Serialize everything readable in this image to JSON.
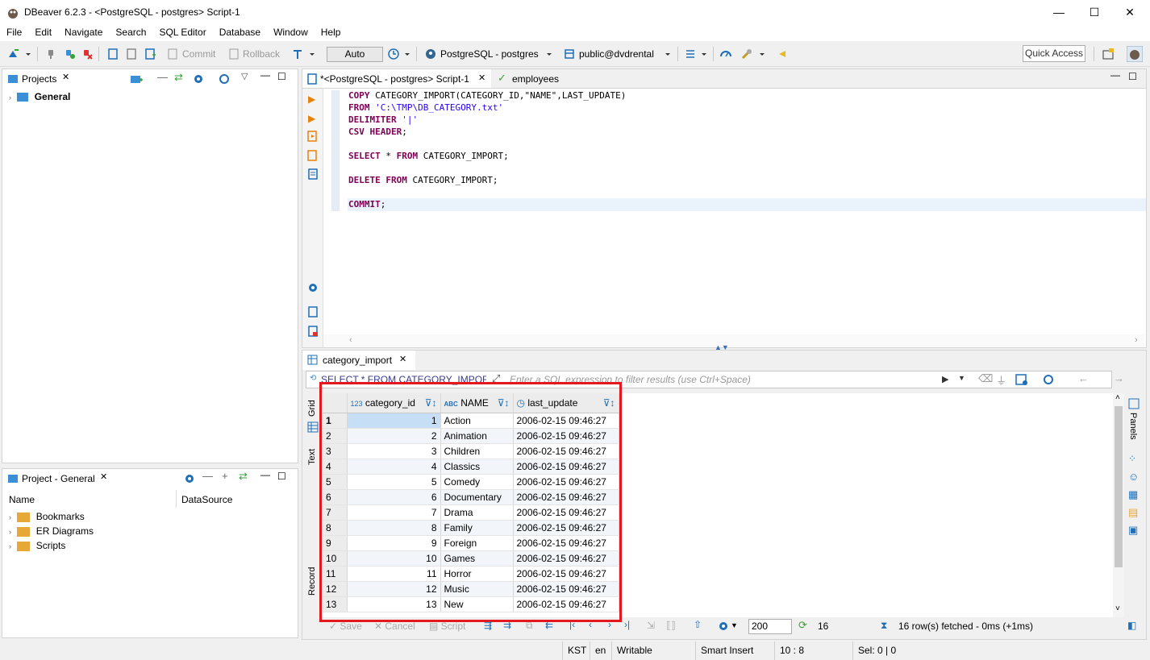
{
  "window": {
    "title": "DBeaver 6.2.3 - <PostgreSQL - postgres> Script-1",
    "minimize": "—",
    "maximize": "☐",
    "close": "✕"
  },
  "menu": [
    "File",
    "Edit",
    "Navigate",
    "Search",
    "SQL Editor",
    "Database",
    "Window",
    "Help"
  ],
  "toolbar": {
    "commit": "Commit",
    "rollback": "Rollback",
    "auto": "Auto",
    "connection": "PostgreSQL - postgres",
    "schema": "public@dvdrental",
    "quick_access": "Quick Access"
  },
  "projects_panel": {
    "title": "Projects",
    "items": [
      "General"
    ]
  },
  "project_general_panel": {
    "title": "Project - General",
    "col_name": "Name",
    "col_datasource": "DataSource",
    "items": [
      "Bookmarks",
      "ER Diagrams",
      "Scripts"
    ]
  },
  "editor": {
    "tabs": [
      "*<PostgreSQL - postgres> Script-1",
      "employees"
    ],
    "lines": [
      {
        "kw": "COPY ",
        "rest": "CATEGORY_IMPORT(CATEGORY_ID,\"NAME\",LAST_UPDATE)"
      },
      {
        "kw": "FROM ",
        "str": "'C:\\TMP\\DB_CATEGORY.txt'"
      },
      {
        "kw": "DELIMITER ",
        "str": "'|'"
      },
      {
        "kw": "CSV HEADER",
        "rest": ";"
      },
      {
        "kw": "SELECT ",
        "rest": "* ",
        "kw2": "FROM ",
        "rest2": "CATEGORY_IMPORT;"
      },
      {
        "kw": "DELETE FROM ",
        "rest": "CATEGORY_IMPORT;"
      },
      {
        "kw": "COMMIT",
        "rest": ";"
      }
    ]
  },
  "results": {
    "tab": "category_import",
    "query": "SELECT * FROM CATEGORY_IMPORT",
    "filter_placeholder": "Enter a SQL expression to filter results (use Ctrl+Space)",
    "side_tabs": [
      "Grid",
      "Text",
      "Record"
    ],
    "panels_label": "Panels",
    "columns": [
      {
        "type": "123",
        "name": "category_id"
      },
      {
        "type": "ABC",
        "name": "NAME"
      },
      {
        "type": "clock",
        "name": "last_update"
      }
    ],
    "rows": [
      [
        "1",
        "1",
        "Action",
        "2006-02-15 09:46:27"
      ],
      [
        "2",
        "2",
        "Animation",
        "2006-02-15 09:46:27"
      ],
      [
        "3",
        "3",
        "Children",
        "2006-02-15 09:46:27"
      ],
      [
        "4",
        "4",
        "Classics",
        "2006-02-15 09:46:27"
      ],
      [
        "5",
        "5",
        "Comedy",
        "2006-02-15 09:46:27"
      ],
      [
        "6",
        "6",
        "Documentary",
        "2006-02-15 09:46:27"
      ],
      [
        "7",
        "7",
        "Drama",
        "2006-02-15 09:46:27"
      ],
      [
        "8",
        "8",
        "Family",
        "2006-02-15 09:46:27"
      ],
      [
        "9",
        "9",
        "Foreign",
        "2006-02-15 09:46:27"
      ],
      [
        "10",
        "10",
        "Games",
        "2006-02-15 09:46:27"
      ],
      [
        "11",
        "11",
        "Horror",
        "2006-02-15 09:46:27"
      ],
      [
        "12",
        "12",
        "Music",
        "2006-02-15 09:46:27"
      ],
      [
        "13",
        "13",
        "New",
        "2006-02-15 09:46:27"
      ]
    ],
    "bottom": {
      "save": "Save",
      "cancel": "Cancel",
      "script": "Script",
      "fetch_size": "200",
      "row_count": "16",
      "status": "16 row(s) fetched - 0ms (+1ms)"
    }
  },
  "statusbar": [
    "KST",
    "en",
    "Writable",
    "Smart Insert",
    "10 : 8",
    "Sel: 0 | 0"
  ]
}
